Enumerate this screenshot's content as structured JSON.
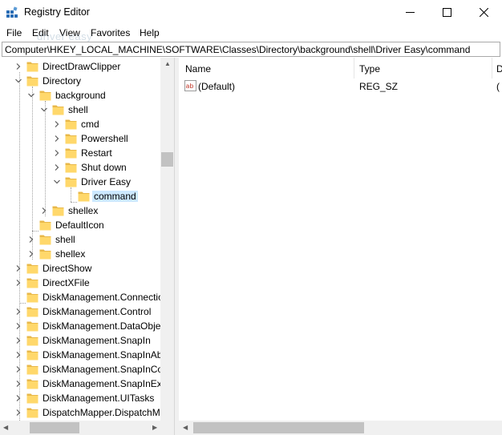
{
  "window": {
    "title": "Registry Editor",
    "icon": "registry-icon"
  },
  "menu": [
    "File",
    "Edit",
    "View",
    "Favorites",
    "Help"
  ],
  "watermark": "driver easy",
  "address": "Computer\\HKEY_LOCAL_MACHINE\\SOFTWARE\\Classes\\Directory\\background\\shell\\Driver Easy\\command",
  "tree": {
    "rows": [
      {
        "label": "DirectDrawClipper",
        "chevron": "right"
      },
      {
        "label": "Directory",
        "chevron": "down"
      },
      {
        "label": "background",
        "chevron": "down"
      },
      {
        "label": "shell",
        "chevron": "down"
      },
      {
        "label": "cmd",
        "chevron": "right"
      },
      {
        "label": "Powershell",
        "chevron": "right"
      },
      {
        "label": "Restart",
        "chevron": "right"
      },
      {
        "label": "Shut down",
        "chevron": "right"
      },
      {
        "label": "Driver Easy",
        "chevron": "down"
      },
      {
        "label": "command",
        "chevron": "none",
        "selected": true
      },
      {
        "label": "shellex",
        "chevron": "right"
      },
      {
        "label": "DefaultIcon",
        "chevron": "none"
      },
      {
        "label": "shell",
        "chevron": "right"
      },
      {
        "label": "shellex",
        "chevron": "right"
      },
      {
        "label": "DirectShow",
        "chevron": "right"
      },
      {
        "label": "DirectXFile",
        "chevron": "right"
      },
      {
        "label": "DiskManagement.Connectio",
        "chevron": "none"
      },
      {
        "label": "DiskManagement.Control",
        "chevron": "right"
      },
      {
        "label": "DiskManagement.DataObje",
        "chevron": "right"
      },
      {
        "label": "DiskManagement.SnapIn",
        "chevron": "right"
      },
      {
        "label": "DiskManagement.SnapInAb",
        "chevron": "right"
      },
      {
        "label": "DiskManagement.SnapInCo",
        "chevron": "right"
      },
      {
        "label": "DiskManagement.SnapInExt",
        "chevron": "right"
      },
      {
        "label": "DiskManagement.UITasks",
        "chevron": "right"
      },
      {
        "label": "DispatchMapper.DispatchM",
        "chevron": "right"
      }
    ]
  },
  "list": {
    "columns": [
      "Name",
      "Type",
      "D"
    ],
    "rows": [
      {
        "icon": "string-value-icon",
        "name": "(Default)",
        "type": "REG_SZ",
        "data": "("
      }
    ]
  },
  "colors": {
    "selection": "#cce8ff",
    "folder": "#ffd86b",
    "folder_dark": "#e8b84a"
  }
}
